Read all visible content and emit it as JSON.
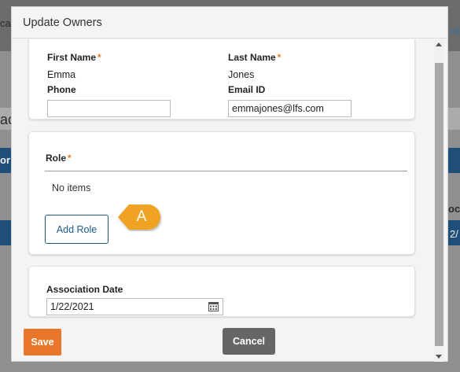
{
  "background": {
    "fragment_left": "ca",
    "fragment_right": "cti",
    "fragment_left_mid": "ac",
    "fragment_left_blue": "or",
    "fragment_right_mid": "oci",
    "fragment_right_blue": "2/"
  },
  "modal": {
    "title": "Update Owners"
  },
  "owner": {
    "first_name_label": "First Name",
    "first_name_value": "Emma",
    "last_name_label": "Last Name",
    "last_name_value": "Jones",
    "phone_label": "Phone",
    "phone_value": "",
    "email_label": "Email ID",
    "email_value": "emmajones@lfs.com",
    "required_marker": "*"
  },
  "role": {
    "label": "Role",
    "empty_text": "No items",
    "add_button_label": "Add Role"
  },
  "callout": {
    "label": "A",
    "color": "#f0a323"
  },
  "association": {
    "label": "Association Date",
    "date_value": "1/22/2021"
  },
  "footer": {
    "save_label": "Save",
    "cancel_label": "Cancel"
  },
  "colors": {
    "save": "#e8772a",
    "cancel": "#666666",
    "link": "#1a5a8a",
    "required": "#e07b1f"
  }
}
